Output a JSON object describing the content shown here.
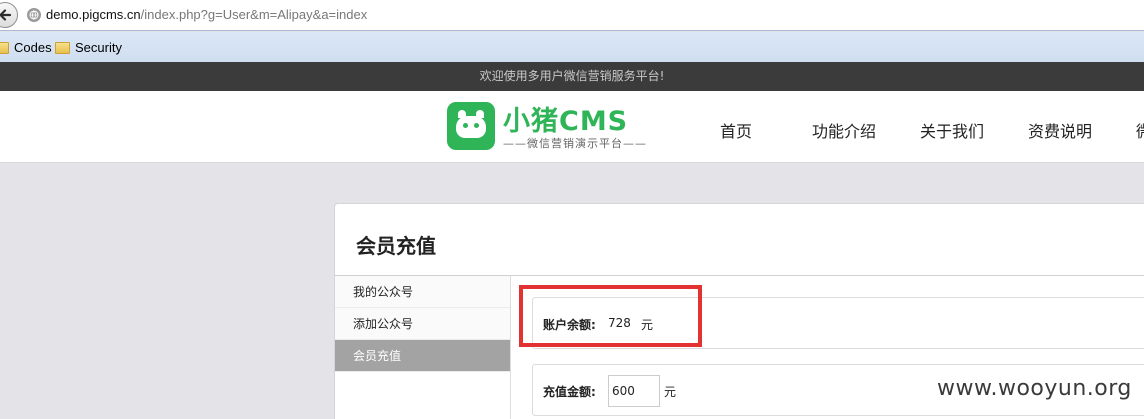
{
  "browser": {
    "url_domain": "demo.pigcms.cn",
    "url_path": "/index.php?g=User&m=Alipay&a=index",
    "bookmarks": [
      "Codes",
      "Security"
    ]
  },
  "notice": "欢迎使用多用户微信营销服务平台!",
  "header": {
    "logo_name": "小猪CMS",
    "logo_sub": "——微信营销演示平台——",
    "nav": [
      "首页",
      "功能介绍",
      "关于我们",
      "资费说明",
      "微"
    ]
  },
  "panel": {
    "title": "会员充值",
    "sidebar": [
      "我的公众号",
      "添加公众号",
      "会员充值"
    ],
    "balance_label": "账户余额:",
    "balance_value": "728",
    "balance_unit": "元",
    "recharge_label": "充值金额:",
    "recharge_value": "600",
    "recharge_unit": "元"
  },
  "watermark": "www.wooyun.org",
  "colors": {
    "brand_green": "#2fb457",
    "highlight_red": "#e23232",
    "active_sidebar": "#a3a3a3"
  }
}
